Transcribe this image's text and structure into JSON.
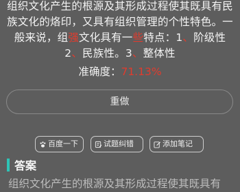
{
  "question": {
    "seg1": "组织文化产生的根源及其形成过程使其既具有民族文化的烙印，又具有组织管理的个性特色。一般来说，组",
    "seg1_red": "强",
    "seg2": "文化具有一",
    "seg2_red": "些",
    "seg3": "特点：1",
    "sep1": "、",
    "seg4": "阶级性 2",
    "sep2": "、",
    "seg5": "民族性。3",
    "sep3": "、",
    "seg6": "整体性"
  },
  "accuracy": {
    "label": "准确度：",
    "value": "71.13%"
  },
  "actions": {
    "redo_label": "重做",
    "baidu_label": "百度一下",
    "report_label": "试题纠错",
    "note_label": "添加笔记"
  },
  "answer": {
    "title": "答案",
    "preview": "组织文化产生的根源及其形成过程使其既具有"
  },
  "colors": {
    "background": "#5d5d5d",
    "highlight": "#e23b2d",
    "accent_bar": "#2ec4b6"
  },
  "icons": [
    "paw-icon",
    "edit-icon",
    "pencil-icon"
  ]
}
